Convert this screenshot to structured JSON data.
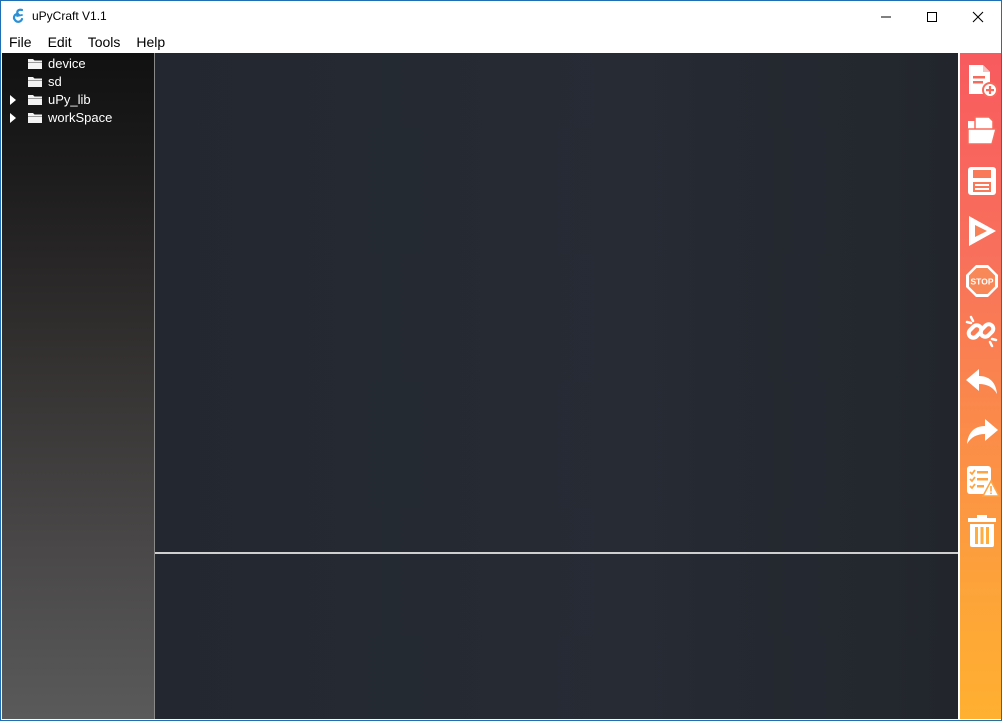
{
  "window": {
    "title": "uPyCraft V1.1",
    "controls": [
      "minimize-icon",
      "maximize-icon",
      "close-icon"
    ]
  },
  "menu": {
    "file": "File",
    "edit": "Edit",
    "tools": "Tools",
    "help": "Help"
  },
  "tree": {
    "items": [
      {
        "label": "device",
        "expandable": false
      },
      {
        "label": "sd",
        "expandable": false
      },
      {
        "label": "uPy_lib",
        "expandable": true
      },
      {
        "label": "workSpace",
        "expandable": true
      }
    ]
  },
  "toolbar": {
    "icons": [
      "new-file-icon",
      "open-file-icon",
      "save-icon",
      "run-icon",
      "stop-icon",
      "disconnect-icon",
      "undo-icon",
      "redo-icon",
      "syntax-check-icon",
      "clear-icon"
    ],
    "stop_text": "STOP"
  },
  "colors": {
    "accent_top": "#f85a5e",
    "accent_bottom": "#ffb030",
    "editor_bg": "#252a32",
    "sidebar_top": "#111111",
    "sidebar_bottom": "#5a5a5a"
  }
}
